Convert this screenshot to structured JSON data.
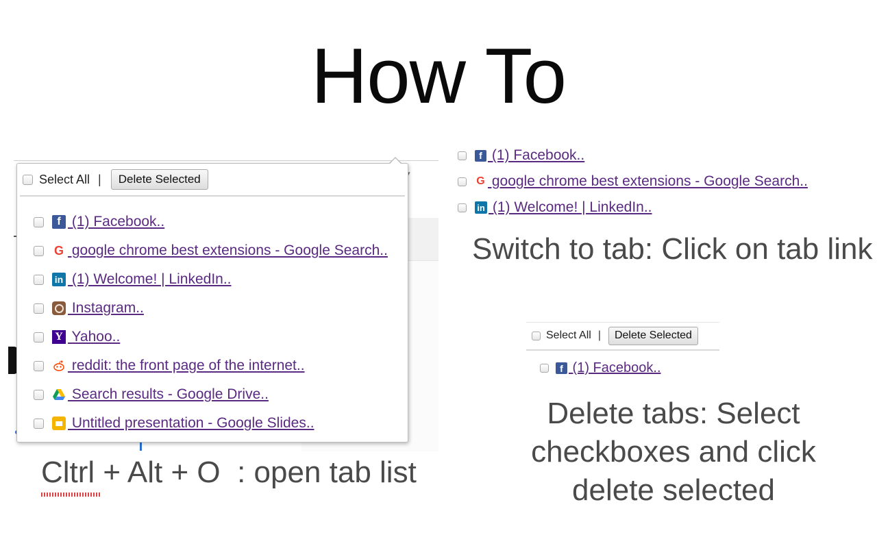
{
  "title": "How To",
  "popup": {
    "select_all_label": "Select All",
    "separator": "|",
    "delete_button": "Delete Selected",
    "tabs": [
      {
        "label": " (1) Facebook..",
        "icon": "facebook-icon"
      },
      {
        "label": " google chrome best extensions - Google Search..",
        "icon": "google-icon"
      },
      {
        "label": " (1) Welcome! | LinkedIn..",
        "icon": "linkedin-icon"
      },
      {
        "label": " Instagram..",
        "icon": "instagram-icon"
      },
      {
        "label": " Yahoo..",
        "icon": "yahoo-icon"
      },
      {
        "label": " reddit: the front page of the internet..",
        "icon": "reddit-icon"
      },
      {
        "label": " Search results - Google Drive..",
        "icon": "google-drive-icon"
      },
      {
        "label": " Untitled presentation - Google Slides..",
        "icon": "google-slides-icon"
      }
    ]
  },
  "switch_example": {
    "tabs": [
      {
        "label": " (1) Facebook..",
        "icon": "facebook-icon"
      },
      {
        "label": " google chrome best extensions - Google Search..",
        "icon": "google-icon"
      },
      {
        "label": " (1) Welcome! | LinkedIn..",
        "icon": "linkedin-icon"
      }
    ],
    "caption": "Switch to tab: Click on tab link"
  },
  "delete_example": {
    "select_all_label": "Select All",
    "separator": "|",
    "delete_button": "Delete Selected",
    "tab": {
      "label": " (1) Facebook..",
      "icon": "facebook-icon"
    },
    "caption_lines": [
      "Delete tabs: Select",
      "checkboxes and click",
      "delete selected"
    ]
  },
  "shortcut_caption": "Cltrl + Alt + O  : open tab list",
  "colors": {
    "link": "#5a2a82",
    "caption": "#4a4a4a",
    "facebook": "#3b5998",
    "linkedin": "#0e76a8",
    "yahoo": "#400090",
    "reddit": "#ff4500",
    "slides": "#f4b400"
  }
}
